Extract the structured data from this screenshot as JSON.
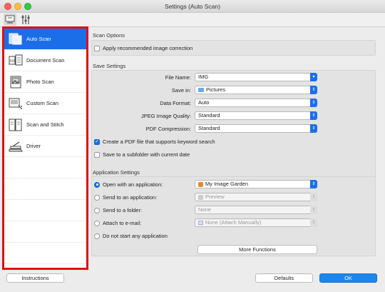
{
  "window": {
    "title": "Settings (Auto Scan)"
  },
  "toolbar": {
    "icons": [
      "scan-settings-icon",
      "general-settings-icon"
    ]
  },
  "sidebar": {
    "items": [
      {
        "label": "Auto Scan",
        "icon": "auto-scan-icon",
        "selected": true
      },
      {
        "label": "Document Scan",
        "icon": "document-scan-icon"
      },
      {
        "label": "Photo Scan",
        "icon": "photo-scan-icon"
      },
      {
        "label": "Custom Scan",
        "icon": "custom-scan-icon"
      },
      {
        "label": "Scan and Stitch",
        "icon": "scan-stitch-icon"
      },
      {
        "label": "Driver",
        "icon": "driver-icon"
      }
    ]
  },
  "scan_options": {
    "title": "Scan Options",
    "apply_recommended": {
      "label": "Apply recommended image correction",
      "checked": false
    }
  },
  "save_settings": {
    "title": "Save Settings",
    "file_name": {
      "label": "File Name:",
      "value": "IMG"
    },
    "save_in": {
      "label": "Save in:",
      "value": "Pictures"
    },
    "data_format": {
      "label": "Data Format:",
      "value": "Auto"
    },
    "jpeg_quality": {
      "label": "JPEG Image Quality:",
      "value": "Standard"
    },
    "pdf_compression": {
      "label": "PDF Compression:",
      "value": "Standard"
    },
    "create_pdf": {
      "label": "Create a PDF file that supports keyword search",
      "checked": true
    },
    "subfolder": {
      "label": "Save to a subfolder with current date",
      "checked": false
    }
  },
  "app_settings": {
    "title": "Application Settings",
    "open_app": {
      "label": "Open with an application:",
      "value": "My Image Garden",
      "checked": true
    },
    "send_app": {
      "label": "Send to an application:",
      "value": "Preview"
    },
    "send_folder": {
      "label": "Send to a folder:",
      "value": "None"
    },
    "attach_email": {
      "label": "Attach to e-mail:",
      "value": "None (Attach Manually)"
    },
    "no_start": {
      "label": "Do not start any application"
    },
    "more_functions": "More Functions"
  },
  "footer": {
    "instructions": "Instructions",
    "defaults": "Defaults",
    "ok": "OK"
  },
  "colors": {
    "accent": "#1c6ee8",
    "highlight_border": "#e01010"
  }
}
